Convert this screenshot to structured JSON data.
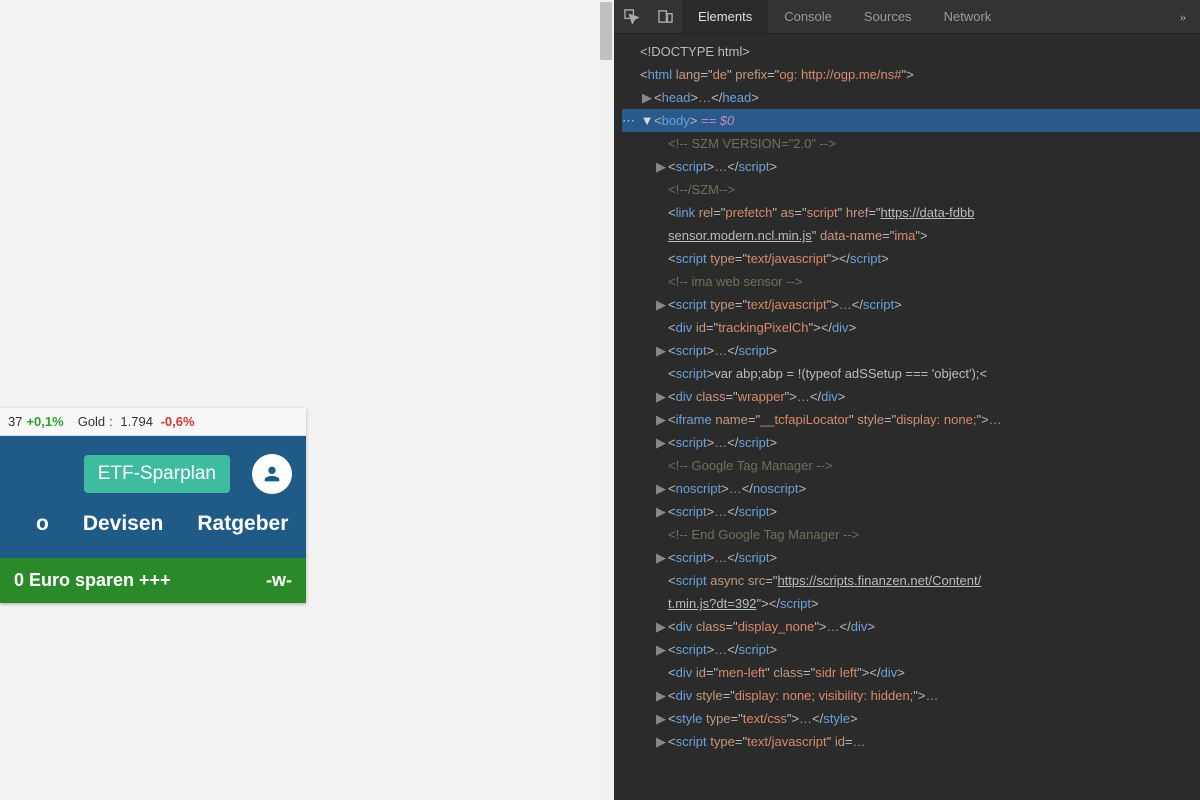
{
  "left": {
    "ticker": {
      "value1": "37",
      "delta1": "+0,1%",
      "label2": "Gold",
      "value2": "1.794",
      "delta2": "-0,6%"
    },
    "etf_button": "ETF-Sparplan",
    "nav": {
      "item1": "o",
      "item2": "Devisen",
      "item3": "Ratgeber"
    },
    "banner": {
      "main": "0 Euro sparen +++",
      "side": "-w-"
    }
  },
  "devtools": {
    "tabs": {
      "elements": "Elements",
      "console": "Console",
      "sources": "Sources",
      "network": "Network",
      "more": "»"
    },
    "tree": {
      "doctype": "<!DOCTYPE html>",
      "html_open": {
        "tag": "html",
        "attrs": [
          [
            "lang",
            "de"
          ],
          [
            "prefix",
            "og: http://ogp.me/ns#"
          ]
        ]
      },
      "head": {
        "open": "<head>",
        "close": "</head>"
      },
      "body_line": {
        "open": "<body>",
        "eq": " == $0"
      },
      "szm_version_comment": "<!-- SZM VERSION=\"2.0\" -->",
      "script_plain": {
        "open": "<script>",
        "close": "</script>"
      },
      "szm_close_comment": "<!--/SZM-->",
      "link_prefetch": {
        "tag": "link",
        "attrs": [
          [
            "rel",
            "prefetch"
          ],
          [
            "as",
            "script"
          ]
        ],
        "href1": "https://data-fdbb",
        "href2": "sensor.modern.ncl.min.js",
        "data_name": "ima"
      },
      "script_textjs": {
        "tag": "script",
        "attr": [
          "type",
          "text/javascript"
        ],
        "close": "</script>"
      },
      "ima_comment": "<!-- ima web sensor -->",
      "tracking_div": {
        "tag": "div",
        "attr": [
          "id",
          "trackingPixelCh"
        ],
        "close": "</div>"
      },
      "abp_script": {
        "open": "<script>",
        "code": "var abp;abp = !(typeof adSSetup === 'object');",
        "close": "<"
      },
      "wrapper_div": {
        "tag": "div",
        "attr": [
          "class",
          "wrapper"
        ],
        "close": "</div>"
      },
      "iframe_tcf": {
        "tag": "iframe",
        "attrs": [
          [
            "name",
            "__tcfapiLocator"
          ],
          [
            "style",
            "display: none;"
          ]
        ]
      },
      "gtm_comment": "<!-- Google Tag Manager -->",
      "noscript": {
        "open": "<noscript>",
        "close": "</noscript>"
      },
      "gtm_end_comment": "<!-- End Google Tag Manager -->",
      "async_script": {
        "tag": "script",
        "async": "async",
        "src1": "https://scripts.finanzen.net/Content/",
        "src2": "t.min.js?dt=392",
        "close": "</script>"
      },
      "display_none_div": {
        "tag": "div",
        "attr": [
          "class",
          "display_none"
        ],
        "close": "</div>"
      },
      "men_left_div": {
        "tag": "div",
        "attrs": [
          [
            "id",
            "men-left"
          ],
          [
            "class",
            "sidr left"
          ]
        ],
        "close": "</div>"
      },
      "hidden_div": {
        "tag": "div",
        "attr": [
          "style",
          "display: none; visibility: hidden;"
        ]
      },
      "style_textcss": {
        "tag": "style",
        "attr": [
          "type",
          "text/css"
        ],
        "close": "</style>"
      },
      "script_textjs_id": {
        "tag": "script",
        "attrs": [
          [
            "type",
            "text/javascript"
          ]
        ],
        "id_shown": "id"
      }
    }
  }
}
